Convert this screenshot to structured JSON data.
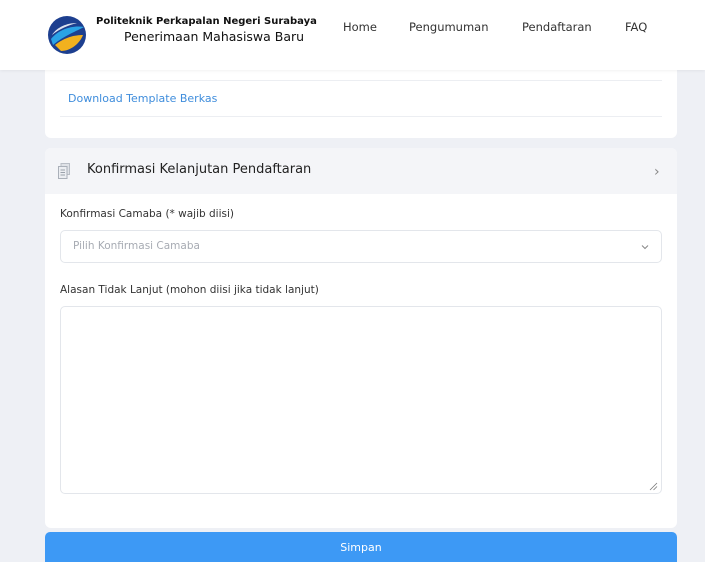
{
  "header": {
    "institution": "Politeknik Perkapalan Negeri Surabaya",
    "subtitle": "Penerimaan Mahasiswa Baru",
    "nav": [
      "Home",
      "Pengumuman",
      "Pendaftaran",
      "FAQ"
    ]
  },
  "documents_card": {
    "download_link": "Download Template Berkas"
  },
  "confirmation_card": {
    "title": "Konfirmasi Kelanjutan Pendaftaran",
    "confirm_label": "Konfirmasi Camaba (* wajib diisi)",
    "confirm_placeholder": "Pilih Konfirmasi Camaba",
    "reason_label": "Alasan Tidak Lanjut (mohon diisi jika tidak lanjut)",
    "reason_value": ""
  },
  "submit_label": "Simpan",
  "colors": {
    "primary": "#3d99f5",
    "link": "#3f8ddc",
    "page_bg": "#eef0f5",
    "section_head_bg": "#f4f5f8"
  },
  "icons": [
    "logo-icon",
    "document-icon",
    "chevron-right-icon",
    "chevron-down-icon",
    "resize-grip-icon"
  ]
}
